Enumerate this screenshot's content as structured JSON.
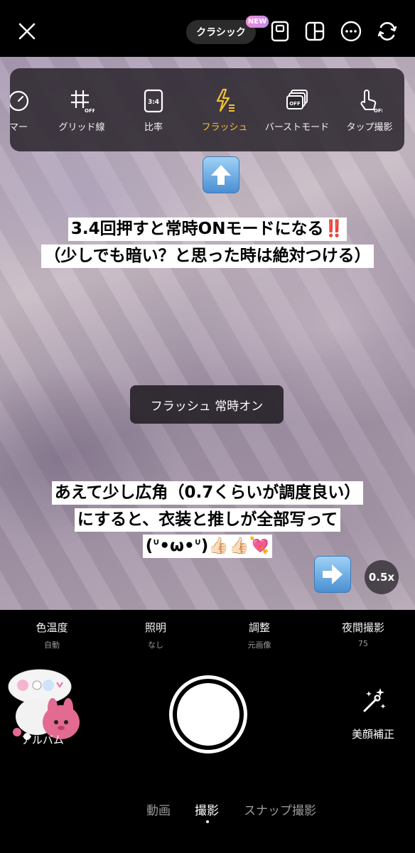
{
  "header": {
    "classic_label": "クラシック",
    "new_badge": "NEW"
  },
  "settings_panel": {
    "items": [
      {
        "label": "マー",
        "icon": "timer-icon"
      },
      {
        "label": "グリッド線",
        "icon": "grid-off-icon",
        "sub": "OFF"
      },
      {
        "label": "比率",
        "icon": "ratio-icon",
        "sub": "3:4"
      },
      {
        "label": "フラッシュ",
        "icon": "flash-icon",
        "active": true
      },
      {
        "label": "バーストモード",
        "icon": "burst-off-icon",
        "sub": "OFF"
      },
      {
        "label": "タップ撮影",
        "icon": "tap-shoot-off-icon",
        "sub": "OFF"
      }
    ],
    "active_color": "#f4c232"
  },
  "annotations": {
    "line1": "3.4回押すと常時ONモードになる",
    "line1_emoji": "‼️",
    "line2": "（少しでも暗い？と思った時は絶対つける）",
    "line3": "あえて少し広角（0.7くらいが調度良い）",
    "line4": "にすると、衣装と推しが全部写って",
    "line5": "(ᐡ•ω•ᐡ)👍🏻👍🏻💘"
  },
  "toast": "フラッシュ 常時オン",
  "zoom": "0.5x",
  "adjustments": [
    {
      "label": "色温度",
      "value": "自動"
    },
    {
      "label": "照明",
      "value": "なし"
    },
    {
      "label": "調整",
      "value": "元画像"
    },
    {
      "label": "夜間撮影",
      "value": "75"
    }
  ],
  "album_label": "アルバム",
  "beauty_label": "美顔補正",
  "modes": [
    "動画",
    "撮影",
    "スナップ撮影"
  ],
  "active_mode": "撮影"
}
